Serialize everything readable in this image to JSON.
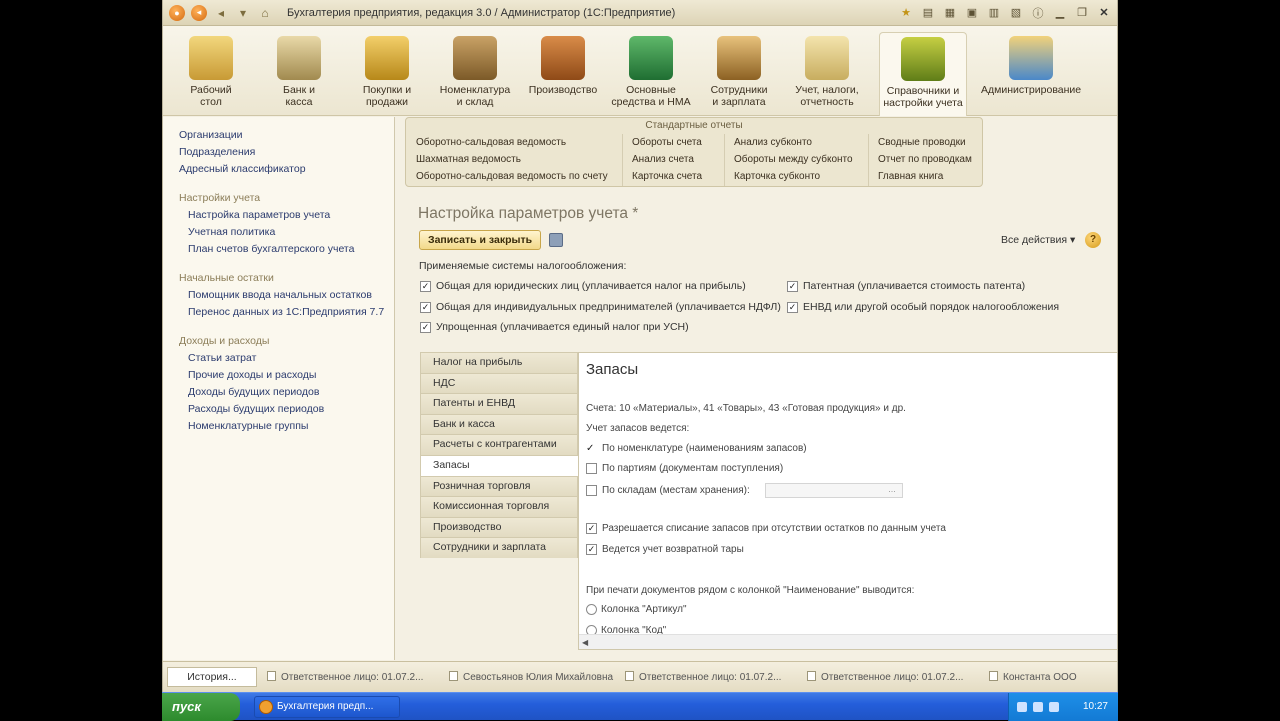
{
  "window": {
    "title": "Бухгалтерия предприятия, редакция 3.0 / Администратор  (1С:Предприятие)"
  },
  "sections": [
    {
      "label": "Рабочий\nстол",
      "icon": "desk-icon"
    },
    {
      "label": "Банк и\nкасса",
      "icon": "bank-icon"
    },
    {
      "label": "Покупки и\nпродажи",
      "icon": "truck-icon"
    },
    {
      "label": "Номенклатура\nи склад",
      "icon": "warehouse-icon"
    },
    {
      "label": "Производство",
      "icon": "toolbox-icon"
    },
    {
      "label": "Основные\nсредства и НМА",
      "icon": "assets-icon"
    },
    {
      "label": "Сотрудники\nи зарплата",
      "icon": "staff-icon"
    },
    {
      "label": "Учет, налоги,\nотчетность",
      "icon": "reports-icon"
    },
    {
      "label": "Справочники и\nнастройки учета",
      "icon": "books-icon"
    },
    {
      "label": "Администрирование",
      "icon": "admin-icon"
    }
  ],
  "leftnav": {
    "top_links": [
      "Организации",
      "Подразделения",
      "Адресный классификатор"
    ],
    "group1": "Настройки учета",
    "group1_links": [
      "Настройка параметров учета",
      "Учетная политика",
      "План счетов бухгалтерского учета"
    ],
    "group2": "Начальные остатки",
    "group2_links": [
      "Помощник ввода начальных остатков",
      "Перенос данных из 1С:Предприятия 7.7"
    ],
    "group3": "Доходы и расходы",
    "group3_links": [
      "Статьи затрат",
      "Прочие доходы и расходы",
      "Доходы будущих периодов",
      "Расходы будущих периодов",
      "Номенклатурные группы"
    ]
  },
  "reports": {
    "title": "Стандартные отчеты",
    "col1": [
      "Оборотно-сальдовая ведомость",
      "Шахматная ведомость",
      "Оборотно-сальдовая ведомость по счету"
    ],
    "col2": [
      "Обороты счета",
      "Анализ счета",
      "Карточка счета"
    ],
    "col3": [
      "Анализ субконто",
      "Обороты между субконто",
      "Карточка субконто"
    ],
    "col4": [
      "Сводные проводки",
      "Отчет по проводкам",
      "Главная книга"
    ]
  },
  "form": {
    "title": "Настройка параметров учета *",
    "save_close": "Записать и закрыть",
    "all_actions": "Все действия ▾",
    "help": "?",
    "tax_label": "Применяемые системы налогообложения:",
    "tax_options": [
      {
        "label": "Общая для юридических лиц (уплачивается налог на прибыль)",
        "checked": true
      },
      {
        "label": "Общая для индивидуальных предпринимателей (уплачивается НДФЛ)",
        "checked": true
      },
      {
        "label": "Упрощенная (уплачивается единый налог при УСН)",
        "checked": true
      },
      {
        "label": "Патентная (уплачивается стоимость патента)",
        "checked": true
      },
      {
        "label": "ЕНВД или другой особый порядок налогообложения",
        "checked": true
      }
    ]
  },
  "tabs": [
    "Налог на прибыль",
    "НДС",
    "Патенты и ЕНВД",
    "Банк и касса",
    "Расчеты с контрагентами",
    "Запасы",
    "Розничная торговля",
    "Комиссионная торговля",
    "Производство",
    "Сотрудники и зарплата"
  ],
  "active_tab": "Запасы",
  "panel": {
    "title": "Запасы",
    "accounts": "Счета: 10 «Материалы», 41 «Товары», 43 «Готовая продукция» и др.",
    "accounting_label": "Учет запасов ведется:",
    "by_nomenclature": "По номенклатуре (наименованиям запасов)",
    "by_batches": "По партиям (документам поступления)",
    "by_warehouses": "По складам (местам хранения):",
    "storage_button": "...",
    "allow_writeoff": "Разрешается списание запасов при отсутствии остатков по данным учета",
    "returnable_packaging": "Ведется учет возвратной тары",
    "print_label": "При печати документов рядом с колонкой \"Наименование\" выводится:",
    "radio_article": "Колонка \"Артикул\"",
    "radio_code": "Колонка \"Код\""
  },
  "history": {
    "button": "История...",
    "items": [
      "Ответственное лицо: 01.07.2...",
      "Севостьянов Юлия Михайловна",
      "Ответственное лицо: 01.07.2...",
      "Ответственное лицо: 01.07.2...",
      "Константа ООО"
    ]
  },
  "taskbar": {
    "start": "пуск",
    "task": "Бухгалтерия предп...",
    "clock": "10:27"
  }
}
